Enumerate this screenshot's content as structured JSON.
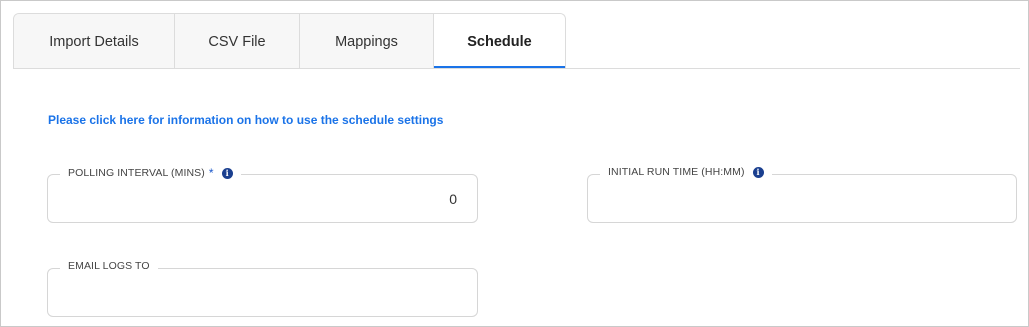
{
  "tabs": [
    {
      "label": "Import Details"
    },
    {
      "label": "CSV File"
    },
    {
      "label": "Mappings"
    },
    {
      "label": "Schedule"
    }
  ],
  "active_tab": "Schedule",
  "info_link": "Please click here for information on how to use the schedule settings",
  "fields": {
    "polling_interval": {
      "label": "POLLING INTERVAL (MINS)",
      "required_marker": "*",
      "value": "0"
    },
    "initial_run_time": {
      "label": "INITIAL RUN TIME (HH:MM)",
      "value": ""
    },
    "email_logs_to": {
      "label": "EMAIL LOGS TO",
      "value": ""
    }
  },
  "icons": {
    "info": "info-circle-icon"
  },
  "colors": {
    "accent": "#1a73e8",
    "info_icon": "#1a3f8f"
  }
}
